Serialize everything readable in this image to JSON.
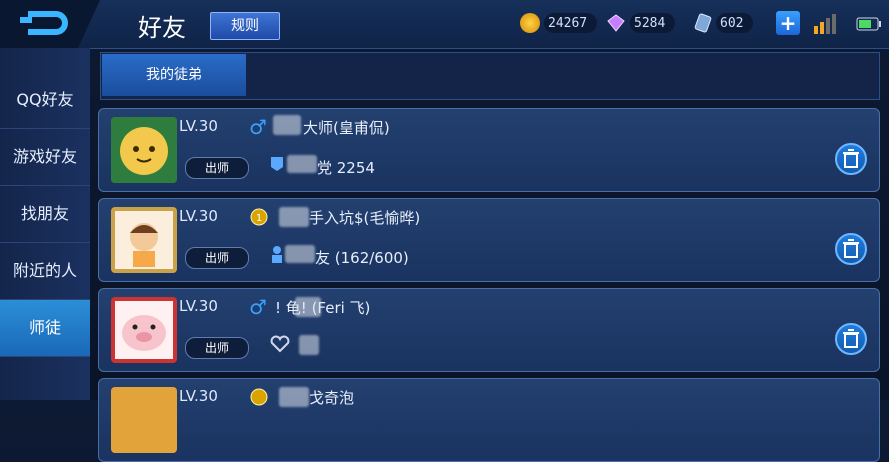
{
  "header": {
    "title": "好友",
    "rules_label": "规则",
    "gold": "24267",
    "diamond": "5284",
    "coupon": "602",
    "plus_label": "+"
  },
  "sidebar": {
    "items": [
      {
        "label": "QQ好友"
      },
      {
        "label": "游戏好友"
      },
      {
        "label": "找朋友"
      },
      {
        "label": "附近的人"
      },
      {
        "label": "师徒"
      }
    ]
  },
  "tabs": [
    {
      "label": "我的徒弟"
    }
  ],
  "list": [
    {
      "level": "LV.30",
      "out_label": "出师",
      "name": "大师(皇甫侃)",
      "sub": "党 2254"
    },
    {
      "level": "LV.30",
      "out_label": "出师",
      "name": "手入坑$(毛愉晔)",
      "sub": "友 (162/600)"
    },
    {
      "level": "LV.30",
      "out_label": "出师",
      "name": "!  龟! (Feri 飞)",
      "sub": ""
    },
    {
      "level": "LV.30",
      "out_label": "",
      "name": "戈奇泡",
      "sub": ""
    }
  ],
  "colors": {
    "accent": "#2c8ed8",
    "badge_bg": "#0e1e3a"
  }
}
